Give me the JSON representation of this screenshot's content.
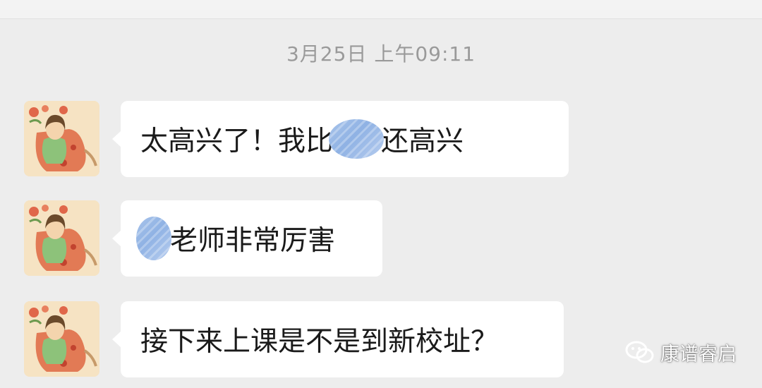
{
  "timestamp": "3月25日 上午09:11",
  "messages": [
    {
      "sender_avatar": "girl-cartoon-avatar",
      "text_before": "太高兴了！我比",
      "redacted": true,
      "text_after": "还高兴"
    },
    {
      "sender_avatar": "girl-cartoon-avatar",
      "text_before": "",
      "redacted": true,
      "text_after": "老师非常厉害"
    },
    {
      "sender_avatar": "girl-cartoon-avatar",
      "text_before": "接下来上课是不是到新校址？",
      "redacted": false,
      "text_after": ""
    }
  ],
  "watermark": {
    "icon": "wechat-icon",
    "text": "康谱睿启"
  },
  "colors": {
    "background": "#ededed",
    "bubble": "#ffffff",
    "timestamp": "#9a9a9a",
    "redaction": "#a9c4ea"
  }
}
